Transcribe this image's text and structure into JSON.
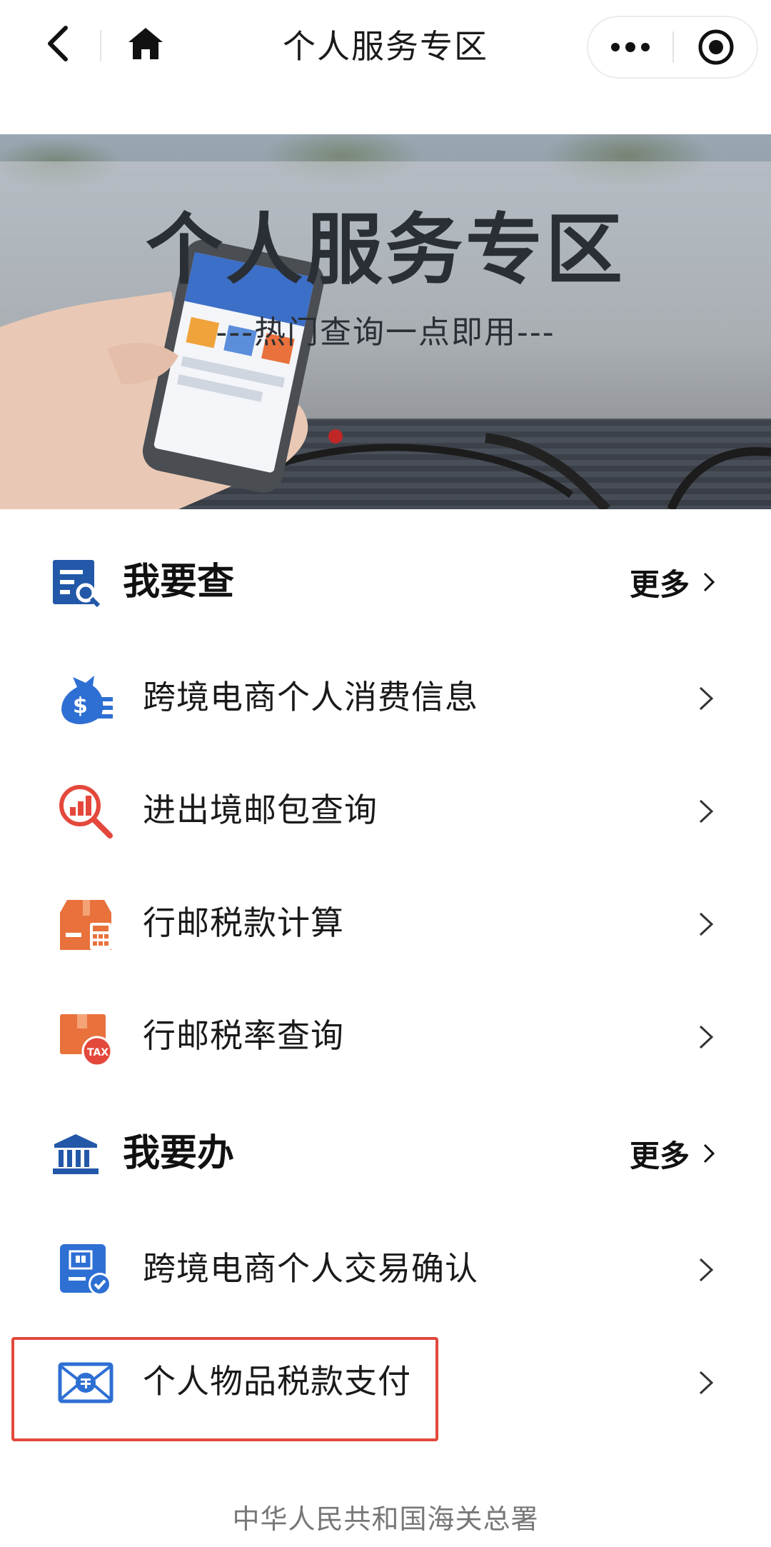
{
  "nav": {
    "title": "个人服务专区"
  },
  "banner": {
    "title": "个人服务专区",
    "subtitle": "---热门查询一点即用---"
  },
  "sections": [
    {
      "title": "我要查",
      "more_label": "更多",
      "items": [
        {
          "label": "跨境电商个人消费信息",
          "icon": "money-bag-icon"
        },
        {
          "label": "进出境邮包查询",
          "icon": "chart-magnifier-icon"
        },
        {
          "label": "行邮税款计算",
          "icon": "package-calculator-icon"
        },
        {
          "label": "行邮税率查询",
          "icon": "package-tax-icon"
        }
      ]
    },
    {
      "title": "我要办",
      "more_label": "更多",
      "items": [
        {
          "label": "跨境电商个人交易确认",
          "icon": "document-check-icon"
        },
        {
          "label": "个人物品税款支付",
          "icon": "envelope-payment-icon"
        }
      ]
    }
  ],
  "footer": {
    "text": "中华人民共和国海关总署"
  },
  "colors": {
    "accent_blue": "#2f6fd0",
    "accent_orange": "#e8713c",
    "highlight_red": "#e2493c"
  }
}
